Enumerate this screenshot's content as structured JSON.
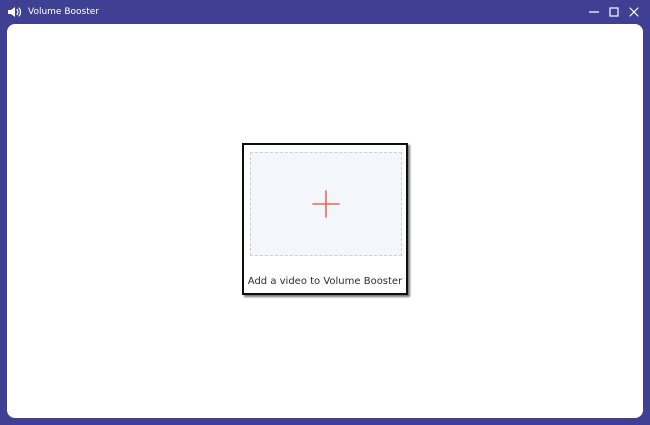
{
  "window": {
    "title": "Volume Booster",
    "app_icon": "speaker-icon",
    "controls": {
      "minimize": "minimize-icon",
      "maximize": "maximize-icon",
      "close": "close-icon"
    }
  },
  "main": {
    "dropzone": {
      "label": "Add a video to Volume Booster",
      "icon": "plus-icon"
    }
  },
  "colors": {
    "frame": "#3f3f93",
    "background": "#ffffff",
    "dropzone_fill": "#f3f6fb",
    "plus": "#ef4b2c",
    "text": "#2e2e2e"
  }
}
